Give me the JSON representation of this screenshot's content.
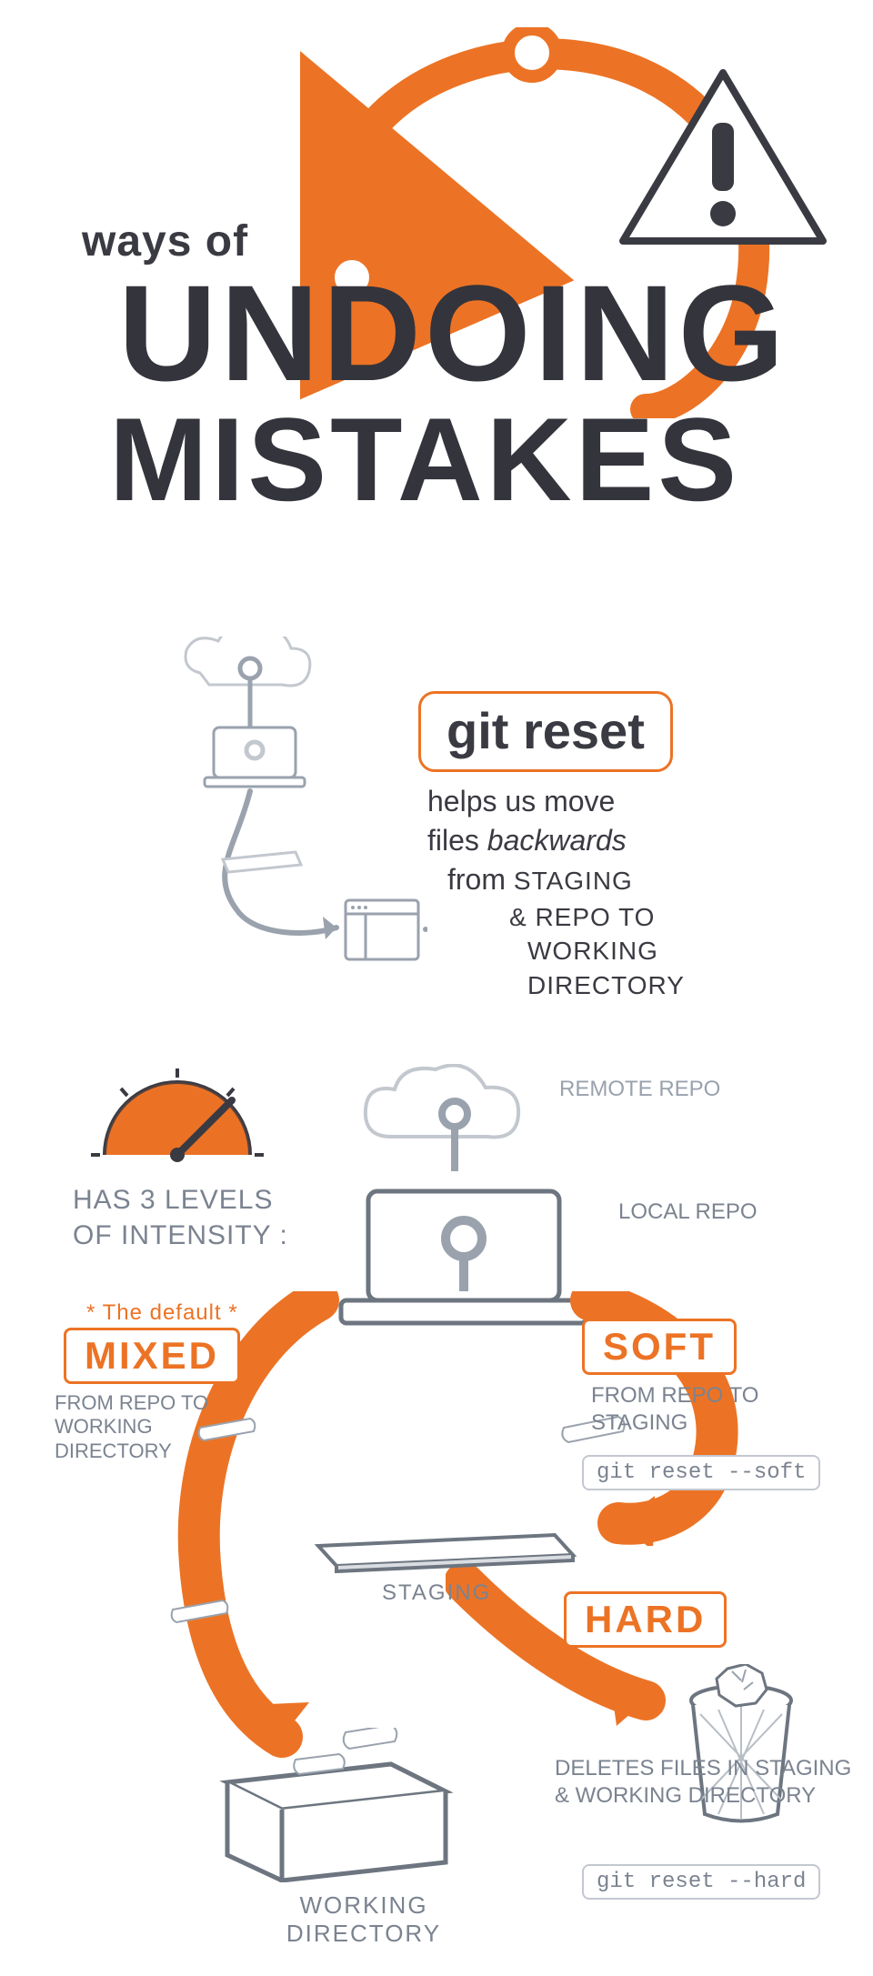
{
  "title": {
    "pre": "ways of",
    "line1": "UNDOING",
    "line2": "MISTAKES"
  },
  "section1": {
    "box": "git reset",
    "desc_line1": "helps us move",
    "desc_line2a": "files ",
    "desc_line2b": "backwards",
    "desc_line3a": "from ",
    "desc_line3b": "STAGING",
    "desc_line4": "& REPO to",
    "desc_line5": "WORKING",
    "desc_line6": "DIRECTORY"
  },
  "section2": {
    "intensity": "Has 3 levels of intensity :",
    "remote": "Remote Repo",
    "local": "Local Repo",
    "default_note": "* The default *",
    "mixed": "MIXED",
    "mixed_desc": "from repo to working directory",
    "soft": "SOFT",
    "soft_desc": "from repo to staging",
    "soft_cmd": "git reset --soft",
    "staging": "STAGING",
    "hard": "HARD",
    "hard_desc": "deletes files in staging & working directory",
    "hard_cmd": "git reset --hard",
    "wd": "WORKING DIRECTORY"
  },
  "colors": {
    "orange": "#ec7325",
    "ink": "#3a3a42",
    "grey": "#8a929d"
  }
}
